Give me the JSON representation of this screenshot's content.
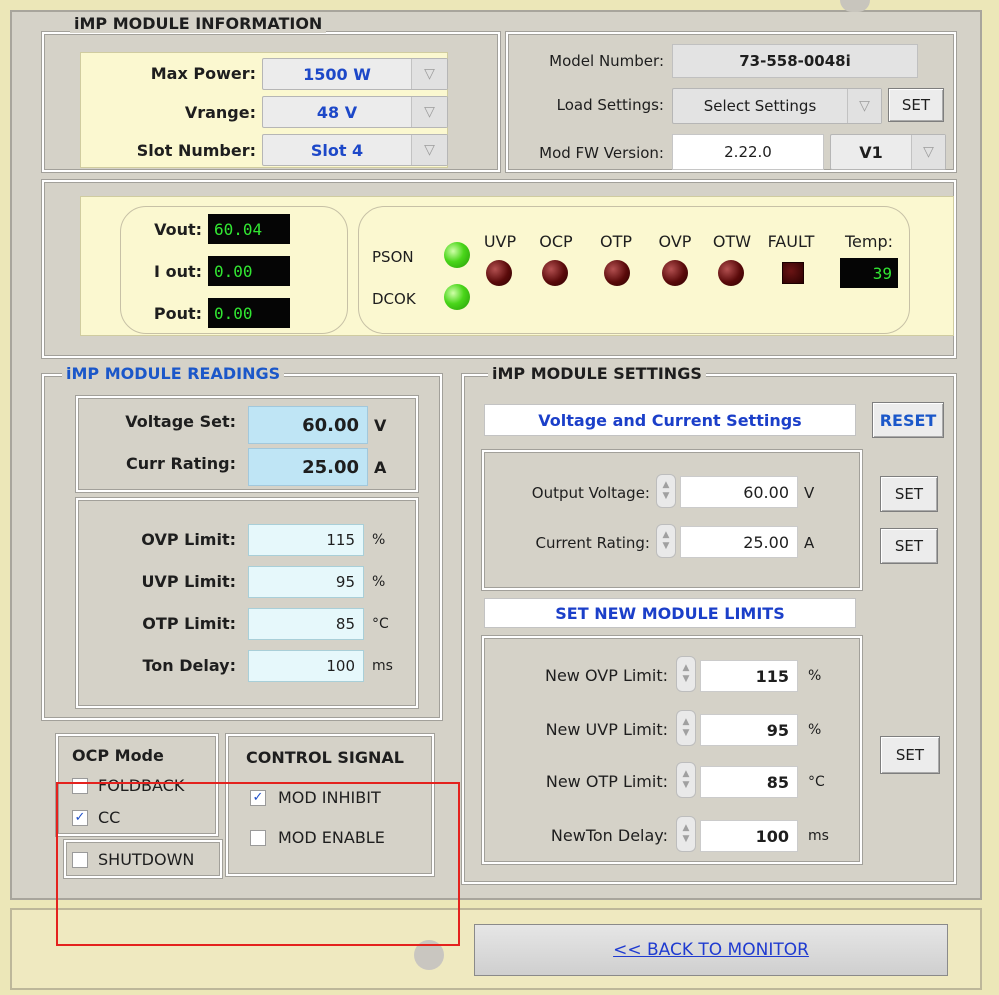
{
  "module_info": {
    "legend": "iMP MODULE INFORMATION",
    "max_power_label": "Max Power:",
    "max_power_value": "1500 W",
    "vrange_label": "Vrange:",
    "vrange_value": "48 V",
    "slot_label": "Slot Number:",
    "slot_value": "Slot 4",
    "model_label": "Model Number:",
    "model_value": "73-558-0048i",
    "load_label": "Load Settings:",
    "load_value": "Select Settings",
    "load_set": "SET",
    "fw_label": "Mod FW Version:",
    "fw_value": "2.22.0",
    "fw_select": "V1"
  },
  "status": {
    "vout_label": "Vout:",
    "vout_value": "60.04",
    "iout_label": "I out:",
    "iout_value": "0.00",
    "pout_label": "Pout:",
    "pout_value": "0.00",
    "pson_label": "PSON",
    "dcok_label": "DCOK",
    "uvp": "UVP",
    "ocp": "OCP",
    "otp": "OTP",
    "ovp": "OVP",
    "otw": "OTW",
    "fault": "FAULT",
    "temp_label": "Temp:",
    "temp_value": "39",
    "colors": {
      "led_on": "#4ad61a",
      "led_off": "#5a0a0a",
      "lcd_text": "#32e632"
    }
  },
  "readings": {
    "legend": "iMP MODULE READINGS",
    "voltage_set_label": "Voltage Set:",
    "voltage_set_value": "60.00",
    "voltage_unit": "V",
    "curr_rating_label": "Curr Rating:",
    "curr_rating_value": "25.00",
    "curr_unit": "A",
    "ovp_label": "OVP Limit:",
    "ovp_value": "115",
    "ovp_unit": "%",
    "uvp_label": "UVP Limit:",
    "uvp_value": "95",
    "uvp_unit": "%",
    "otp_label": "OTP Limit:",
    "otp_value": "85",
    "otp_unit": "°C",
    "ton_label": "Ton Delay:",
    "ton_value": "100",
    "ton_unit": "ms"
  },
  "ocp_mode": {
    "title": "OCP Mode",
    "foldback": "FOLDBACK",
    "cc": "CC",
    "shutdown": "SHUTDOWN",
    "cc_checked": "✓"
  },
  "control_signal": {
    "title": "CONTROL SIGNAL",
    "mod_inhibit": "MOD INHIBIT",
    "mod_enable": "MOD ENABLE",
    "inhibit_checked": "✓"
  },
  "settings": {
    "legend": "iMP MODULE SETTINGS",
    "vc_header": "Voltage and Current Settings",
    "reset": "RESET",
    "out_voltage_label": "Output Voltage:",
    "out_voltage_value": "60.00",
    "out_voltage_unit": "V",
    "current_rating_label": "Current Rating:",
    "current_rating_value": "25.00",
    "current_rating_unit": "A",
    "set": "SET",
    "limits_header": "SET NEW MODULE LIMITS",
    "new_ovp_label": "New OVP Limit:",
    "new_ovp_value": "115",
    "new_ovp_unit": "%",
    "new_uvp_label": "New UVP Limit:",
    "new_uvp_value": "95",
    "new_uvp_unit": "%",
    "new_otp_label": "New OTP Limit:",
    "new_otp_value": "85",
    "new_otp_unit": "°C",
    "new_ton_label": "NewTon Delay:",
    "new_ton_value": "100",
    "new_ton_unit": "ms"
  },
  "footer": {
    "back_label": "<< BACK TO MONITOR"
  }
}
